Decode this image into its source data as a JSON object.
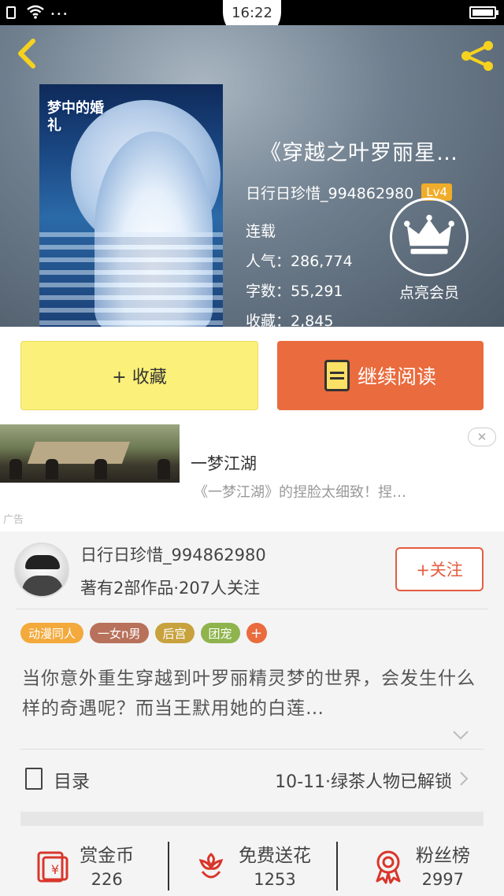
{
  "status_bar": {
    "time": "16:22"
  },
  "book": {
    "title": "《穿越之叶罗丽星…",
    "cover_text": "梦中的婚礼",
    "author": "日行日珍惜_994862980",
    "level": "Lv4",
    "status": "连载",
    "popularity_label": "人气：",
    "popularity": "286,774",
    "word_count_label": "字数：",
    "word_count": "55,291",
    "favorites_label": "收藏：",
    "favorites": "2,845",
    "vip_label": "点亮会员"
  },
  "actions": {
    "collect_label": "+ 收藏",
    "read_label": "继续阅读"
  },
  "ad": {
    "title": "一梦江湖",
    "description": "《一梦江湖》的捏脸太细致！捏…",
    "close_label": "✕",
    "tag": "广告"
  },
  "author_card": {
    "name": "日行日珍惜_994862980",
    "stats": "著有2部作品·207人关注",
    "follow_label": "+关注"
  },
  "tags": [
    {
      "label": "动漫同人",
      "color": "#f3a93c"
    },
    {
      "label": "一女n男",
      "color": "#b8715b"
    },
    {
      "label": "后宫",
      "color": "#c7a23d"
    },
    {
      "label": "团宠",
      "color": "#8fb44d"
    }
  ],
  "tag_plus": "+",
  "synopsis": "当你意外重生穿越到叶罗丽精灵梦的世界，会发生什么样的奇遇呢？而当王默用她的白莲…",
  "catalog": {
    "label": "目录",
    "latest": "10-11·绿茶人物已解锁"
  },
  "rewards": [
    {
      "label": "赏金币",
      "value": "226",
      "icon": "red-envelope-icon"
    },
    {
      "label": "免费送花",
      "value": "1253",
      "icon": "flower-icon"
    },
    {
      "label": "粉丝榜",
      "value": "2997",
      "icon": "medal-icon"
    }
  ],
  "colors": {
    "accent": "#ea6b3d",
    "collect_bg": "#fbf07a",
    "level_badge": "#f0ad2a",
    "follow": "#e45d3f"
  }
}
